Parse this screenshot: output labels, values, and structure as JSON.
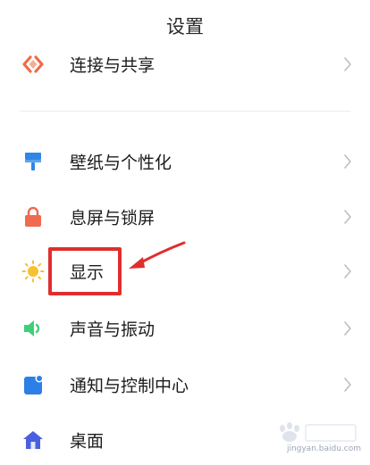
{
  "header": {
    "title": "设置"
  },
  "settings": {
    "items": [
      {
        "label": "连接与共享",
        "icon": "share-connection-icon",
        "color": "#f06a45"
      },
      {
        "label": "壁纸与个性化",
        "icon": "paint-brush-icon",
        "color": "#2f86e8"
      },
      {
        "label": "息屏与锁屏",
        "icon": "lock-icon",
        "color": "#ef6a4f"
      },
      {
        "label": "显示",
        "icon": "sun-icon",
        "color": "#f7c12f"
      },
      {
        "label": "声音与振动",
        "icon": "speaker-icon",
        "color": "#3fcf7b"
      },
      {
        "label": "通知与控制中心",
        "icon": "notification-icon",
        "color": "#2c7fe6"
      },
      {
        "label": "桌面",
        "icon": "home-icon",
        "color": "#4a5fe0"
      }
    ]
  },
  "annotation": {
    "highlight_color": "#e02e2e",
    "highlighted_item": "显示"
  },
  "watermark": {
    "text": "jingyan.baidu.com"
  }
}
